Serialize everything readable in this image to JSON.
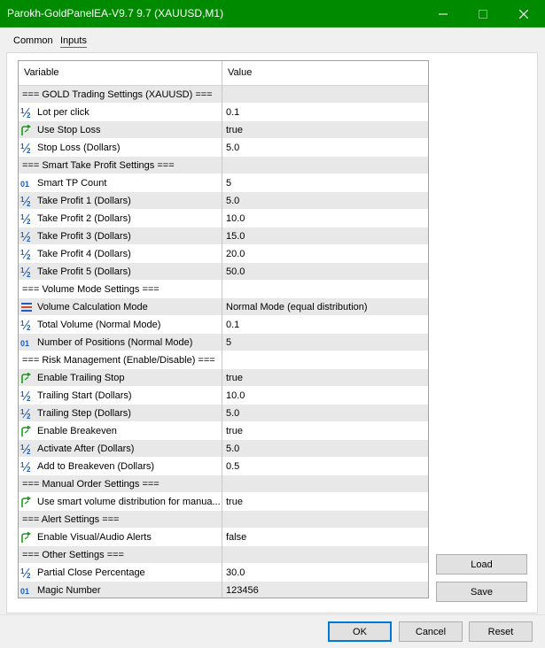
{
  "window": {
    "title": "Parokh-GoldPanelEA-V9.7 9.7 (XAUUSD,M1)",
    "accent": "#008a00"
  },
  "tabs": [
    {
      "label": "Common",
      "active": false
    },
    {
      "label": "Inputs",
      "active": true
    }
  ],
  "grid": {
    "col_variable": "Variable",
    "col_value": "Value",
    "rows": [
      {
        "type": "section",
        "variable": "=== GOLD Trading Settings (XAUUSD) ===",
        "value": "",
        "icon": ""
      },
      {
        "type": "param",
        "variable": "Lot per click",
        "value": "0.1",
        "icon": "double-icon"
      },
      {
        "type": "param",
        "variable": "Use Stop Loss",
        "value": "true",
        "icon": "bool-icon"
      },
      {
        "type": "param",
        "variable": "Stop Loss (Dollars)",
        "value": "5.0",
        "icon": "double-icon"
      },
      {
        "type": "section",
        "variable": "=== Smart Take Profit Settings ===",
        "value": "",
        "icon": ""
      },
      {
        "type": "param",
        "variable": "Smart TP Count",
        "value": "5",
        "icon": "int-icon"
      },
      {
        "type": "param",
        "variable": "Take Profit 1 (Dollars)",
        "value": "5.0",
        "icon": "double-icon"
      },
      {
        "type": "param",
        "variable": "Take Profit 2 (Dollars)",
        "value": "10.0",
        "icon": "double-icon"
      },
      {
        "type": "param",
        "variable": "Take Profit 3 (Dollars)",
        "value": "15.0",
        "icon": "double-icon"
      },
      {
        "type": "param",
        "variable": "Take Profit 4 (Dollars)",
        "value": "20.0",
        "icon": "double-icon"
      },
      {
        "type": "param",
        "variable": "Take Profit 5 (Dollars)",
        "value": "50.0",
        "icon": "double-icon"
      },
      {
        "type": "section",
        "variable": "=== Volume Mode Settings ===",
        "value": "",
        "icon": ""
      },
      {
        "type": "param",
        "variable": "Volume Calculation Mode",
        "value": "Normal Mode (equal distribution)",
        "icon": "enum-icon"
      },
      {
        "type": "param",
        "variable": "Total Volume (Normal Mode)",
        "value": "0.1",
        "icon": "double-icon"
      },
      {
        "type": "param",
        "variable": "Number of Positions (Normal Mode)",
        "value": "5",
        "icon": "int-icon"
      },
      {
        "type": "section",
        "variable": "=== Risk Management (Enable/Disable) ===",
        "value": "",
        "icon": ""
      },
      {
        "type": "param",
        "variable": "Enable Trailing Stop",
        "value": "true",
        "icon": "bool-icon"
      },
      {
        "type": "param",
        "variable": "Trailing Start (Dollars)",
        "value": "10.0",
        "icon": "double-icon"
      },
      {
        "type": "param",
        "variable": "Trailing Step (Dollars)",
        "value": "5.0",
        "icon": "double-icon"
      },
      {
        "type": "param",
        "variable": "Enable Breakeven",
        "value": "true",
        "icon": "bool-icon"
      },
      {
        "type": "param",
        "variable": "Activate After (Dollars)",
        "value": "5.0",
        "icon": "double-icon"
      },
      {
        "type": "param",
        "variable": "Add to Breakeven (Dollars)",
        "value": "0.5",
        "icon": "double-icon"
      },
      {
        "type": "section",
        "variable": "=== Manual Order Settings ===",
        "value": "",
        "icon": ""
      },
      {
        "type": "param",
        "variable": "Use smart volume distribution for manua...",
        "value": "true",
        "icon": "bool-icon"
      },
      {
        "type": "section",
        "variable": "=== Alert Settings ===",
        "value": "",
        "icon": ""
      },
      {
        "type": "param",
        "variable": "Enable Visual/Audio Alerts",
        "value": "false",
        "icon": "bool-icon"
      },
      {
        "type": "section",
        "variable": "=== Other Settings ===",
        "value": "",
        "icon": ""
      },
      {
        "type": "param",
        "variable": "Partial Close Percentage",
        "value": "30.0",
        "icon": "double-icon"
      },
      {
        "type": "param",
        "variable": "Magic Number",
        "value": "123456",
        "icon": "int-icon"
      }
    ]
  },
  "side_buttons": {
    "load": "Load",
    "save": "Save"
  },
  "footer_buttons": {
    "ok": "OK",
    "cancel": "Cancel",
    "reset": "Reset"
  }
}
